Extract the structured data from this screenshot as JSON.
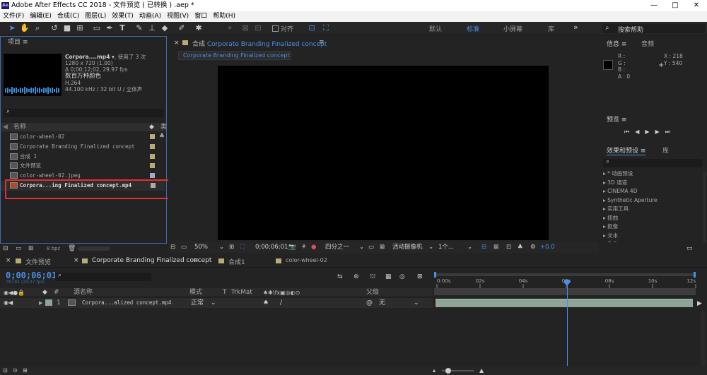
{
  "window": {
    "title": "Adobe After Effects CC 2018 - 文件预览 ( 已转换 ) .aep *",
    "minimize": "—",
    "maximize": "□",
    "close": "✕"
  },
  "menu": [
    "文件(F)",
    "编辑(E)",
    "合成(C)",
    "图层(L)",
    "效果(T)",
    "动画(A)",
    "视图(V)",
    "窗口",
    "帮助(H)"
  ],
  "toolbar": {
    "snap_label": "对齐",
    "workspaces": [
      "默认",
      "标准",
      "小屏幕",
      "库"
    ],
    "active_workspace": "标准",
    "search_placeholder": "搜索帮助",
    "more": "»"
  },
  "project": {
    "tab": "项目",
    "preview_name": "Corpora....mp4 ▾",
    "used": ", 使用了 3 次",
    "dims": "1280 x 720 (1.00)",
    "duration": "Δ 0;00;12;02, 29.97 fps",
    "color": "数百万种颜色",
    "codec": "H.264",
    "audio": "44.100 kHz / 32 bit U / 立体声",
    "search_placeholder": "",
    "col_name": "名称",
    "col_type": "类",
    "items": [
      {
        "name": "color-wheel-02",
        "swatch": "#bba976"
      },
      {
        "name": "Corporate Branding  Finalized concept",
        "swatch": "#bba976"
      },
      {
        "name": "合成 1",
        "swatch": "#bba976"
      },
      {
        "name": "文件预览",
        "swatch": "#bba976"
      },
      {
        "name": "color-wheel-02.jpeg",
        "swatch": "#a7a7c7"
      },
      {
        "name": "Corpora...ing  Finalized concept.mp4",
        "swatch": "#aaaaaa",
        "selected": true
      }
    ],
    "bpc": "8 bpc"
  },
  "comp": {
    "tab_prefix": "合成",
    "tab_name": "Corporate Branding  Finalized concept",
    "subtab": "Corporate Branding  Finalized concept",
    "zoom": "50%",
    "timecode": "0;00;06;01",
    "resolution": "四分之一",
    "camera": "活动摄像机",
    "views": "1个...",
    "exposure": "+0.0"
  },
  "info": {
    "tab1": "信息",
    "tab2": "音频",
    "r": "R :",
    "g": "G :",
    "b": "B :",
    "a": "A :  0",
    "x": "X : 218",
    "y": "Y : 540"
  },
  "preview": {
    "tab": "预览"
  },
  "effects": {
    "tab1": "效果和预设",
    "tab2": "库",
    "items": [
      "▸ * 动画预设",
      "▸ 3D 通道",
      "▸ CINEMA 4D",
      "▸ Synthetic Aperture",
      "▸ 实用工具",
      "▸ 扭曲",
      "▸ 抠像",
      "▸ 文本",
      "▸ 杂色"
    ]
  },
  "timeline": {
    "tabs": [
      "文件预览",
      "Corporate Branding  Finalized concept",
      "合成1",
      "color-wheel-02"
    ],
    "timecode": "0;00;06;01",
    "frames": "00181 (29.97 fps)",
    "col_name": "源名称",
    "col_mode": "模式",
    "col_t": "T",
    "col_trkmat": "TrkMat",
    "col_parent": "父级",
    "layer": {
      "num": "1",
      "name": "Corpora...alized concept.mp4",
      "mode": "正常",
      "parent": "无"
    },
    "ruler": [
      "0:00s",
      "02s",
      "04s",
      "06s",
      "08s",
      "10s",
      "12s"
    ],
    "playhead_seconds": 6.03,
    "duration_seconds": 12.07
  },
  "colors": {
    "accent": "#4a8fe8",
    "selection_box": "#e03030",
    "layer_bar": "#8ca597"
  }
}
